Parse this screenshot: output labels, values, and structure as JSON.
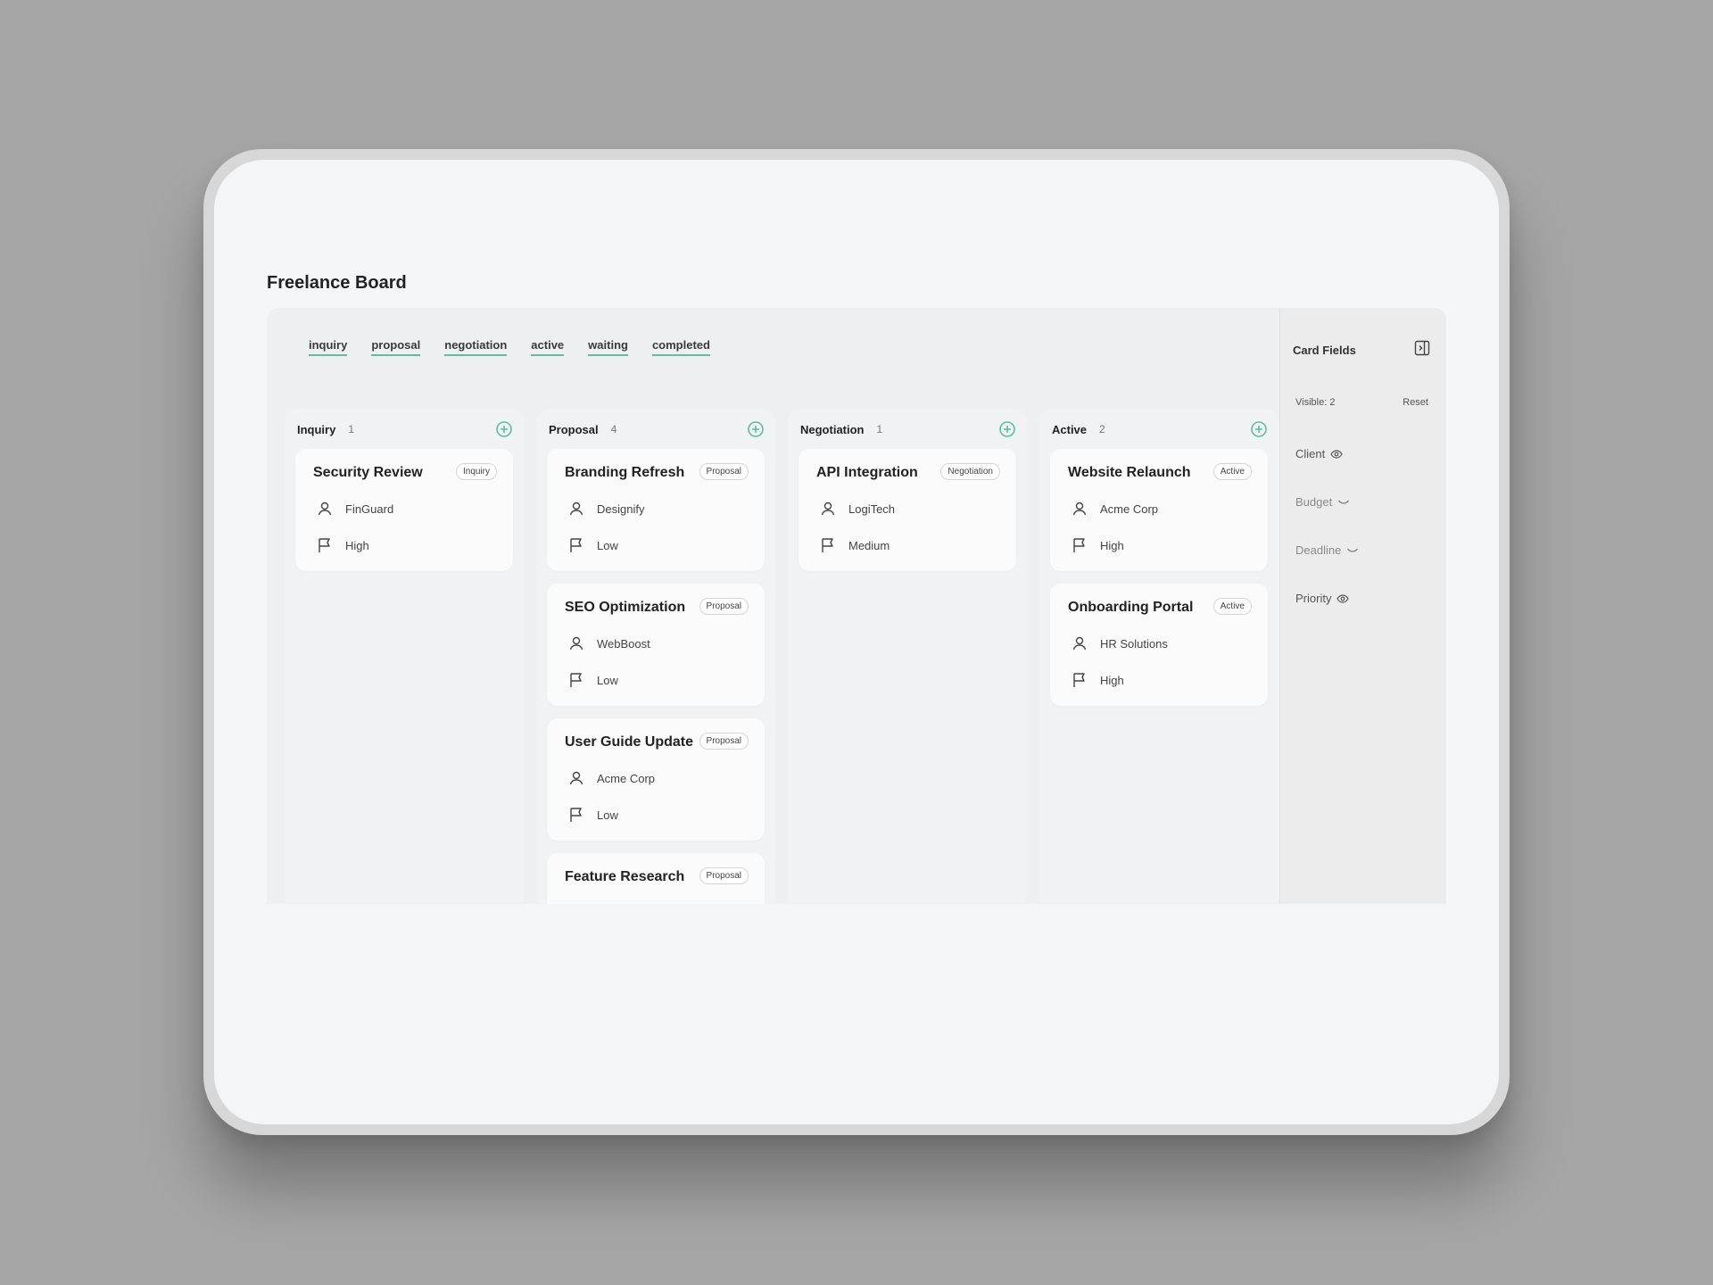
{
  "app": {
    "title": "Freelance Board"
  },
  "filters": [
    "inquiry",
    "proposal",
    "negotiation",
    "active",
    "waiting",
    "completed"
  ],
  "accent": "#5cbfa0",
  "columns": [
    {
      "name": "Inquiry",
      "count": "1",
      "cards": [
        {
          "title": "Security Review",
          "badge": "Inquiry",
          "client": "FinGuard",
          "priority": "High"
        }
      ]
    },
    {
      "name": "Proposal",
      "count": "4",
      "cards": [
        {
          "title": "Branding Refresh",
          "badge": "Proposal",
          "client": "Designify",
          "priority": "Low"
        },
        {
          "title": "SEO Optimization",
          "badge": "Proposal",
          "client": "WebBoost",
          "priority": "Low"
        },
        {
          "title": "User Guide Update",
          "badge": "Proposal",
          "client": "Acme Corp",
          "priority": "Low"
        },
        {
          "title": "Feature Research",
          "badge": "Proposal"
        }
      ]
    },
    {
      "name": "Negotiation",
      "count": "1",
      "cards": [
        {
          "title": "API Integration",
          "badge": "Negotiation",
          "client": "LogiTech",
          "priority": "Medium"
        }
      ]
    },
    {
      "name": "Active",
      "count": "2",
      "cards": [
        {
          "title": "Website Relaunch",
          "badge": "Active",
          "client": "Acme Corp",
          "priority": "High"
        },
        {
          "title": "Onboarding Portal",
          "badge": "Active",
          "client": "HR Solutions",
          "priority": "High"
        }
      ]
    }
  ],
  "side_panel": {
    "title": "Card Fields",
    "visible_label": "Visible: 2",
    "reset_label": "Reset",
    "fields": [
      {
        "label": "Client",
        "state": "visible",
        "icon": "eye-icon"
      },
      {
        "label": "Budget",
        "state": "hidden",
        "icon": "eye-closed-icon"
      },
      {
        "label": "Deadline",
        "state": "hidden",
        "icon": "eye-closed-icon"
      },
      {
        "label": "Priority",
        "state": "visible",
        "icon": "eye-icon"
      }
    ]
  }
}
